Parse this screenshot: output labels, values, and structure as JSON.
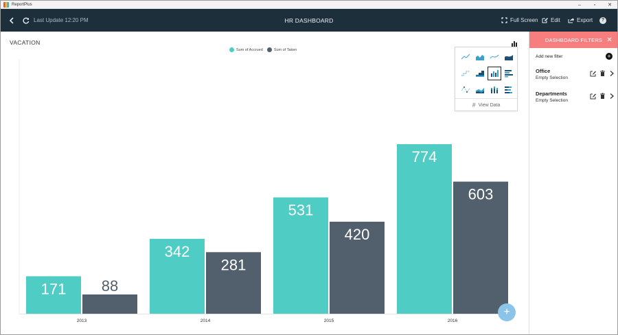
{
  "window": {
    "app_name": "ReportPlus",
    "minimize": "–",
    "maximize": "▫",
    "close": "✕"
  },
  "toolbar": {
    "last_update": "Last Update 12:20 PM",
    "title": "HR DASHBOARD",
    "full_screen": "Full Screen",
    "edit": "Edit",
    "export": "Export",
    "help": "?"
  },
  "widget": {
    "title": "VACATION"
  },
  "chart_type_menu": {
    "icons": [
      "line",
      "area",
      "spline",
      "spline-area",
      "step-line",
      "step-area",
      "column",
      "bar",
      "scatter",
      "stacked-area",
      "stacked-column",
      "stacked-bar"
    ],
    "active": "column",
    "view_data": "View Data"
  },
  "chart_data": {
    "type": "bar",
    "categories": [
      "2013",
      "2014",
      "2015",
      "2016"
    ],
    "series": [
      {
        "name": "Sum of Accrued",
        "values": [
          171,
          342,
          531,
          774
        ],
        "color": "#4fcdc4"
      },
      {
        "name": "Sum of Taken",
        "values": [
          88,
          281,
          420,
          603
        ],
        "color": "#525f6c"
      }
    ],
    "ylim": [
      0,
      774
    ],
    "grid": false,
    "legend": "top-center",
    "data_labels": true
  },
  "panel": {
    "header": "DASHBOARD FILTERS",
    "close": "✕",
    "add_filter": "Add new filter",
    "filters": [
      {
        "name": "Office",
        "value": "Empty Selection"
      },
      {
        "name": "Departments",
        "value": "Empty Selection"
      }
    ]
  },
  "fab": {
    "label": "+"
  }
}
